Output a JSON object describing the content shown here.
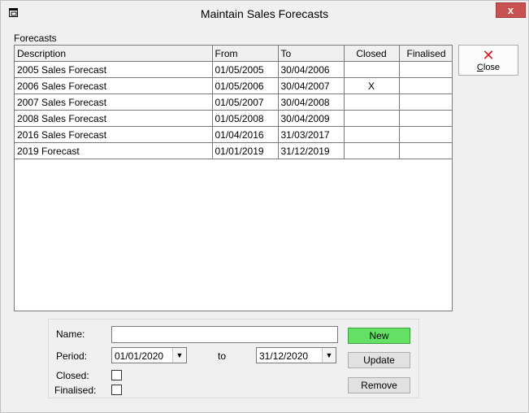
{
  "window": {
    "title": "Maintain Sales Forecasts",
    "close_glyph": "x"
  },
  "forecasts": {
    "group_label": "Forecasts",
    "columns": [
      "Description",
      "From",
      "To",
      "Closed",
      "Finalised"
    ],
    "rows": [
      {
        "description": "2005 Sales Forecast",
        "from": "01/05/2005",
        "to": "30/04/2006",
        "closed": "",
        "finalised": ""
      },
      {
        "description": "2006 Sales Forecast",
        "from": "01/05/2006",
        "to": "30/04/2007",
        "closed": "X",
        "finalised": ""
      },
      {
        "description": "2007 Sales Forecast",
        "from": "01/05/2007",
        "to": "30/04/2008",
        "closed": "",
        "finalised": ""
      },
      {
        "description": "2008 Sales Forecast",
        "from": "01/05/2008",
        "to": "30/04/2009",
        "closed": "",
        "finalised": ""
      },
      {
        "description": "2016 Sales Forecast",
        "from": "01/04/2016",
        "to": "31/03/2017",
        "closed": "",
        "finalised": ""
      },
      {
        "description": "2019 Forecast",
        "from": "01/01/2019",
        "to": "31/12/2019",
        "closed": "",
        "finalised": ""
      }
    ]
  },
  "close_button": {
    "icon": "close-icon",
    "icon_glyph": "✕",
    "label_first": "C",
    "label_rest": "lose",
    "icon_color": "#d01c28"
  },
  "form": {
    "name_label": "Name:",
    "name_value": "",
    "period_label": "Period:",
    "period_from": "01/01/2020",
    "to_label": "to",
    "period_to": "31/12/2020",
    "closed_label": "Closed:",
    "finalised_label": "Finalised:",
    "new_label": "New",
    "update_label": "Update",
    "remove_label": "Remove",
    "new_color": "#64e064"
  }
}
